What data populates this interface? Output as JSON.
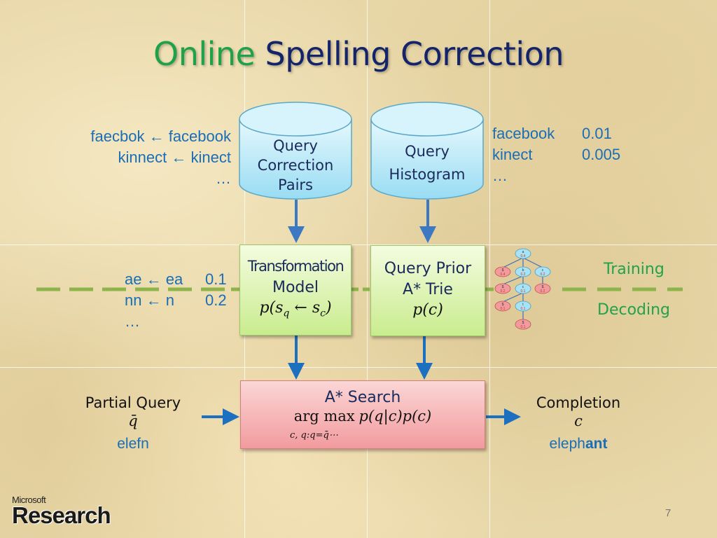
{
  "slide": {
    "title_highlight": "Online",
    "title_rest": "Spelling Correction",
    "page_number": "7",
    "logo": {
      "top": "Microsoft",
      "bottom": "Research"
    }
  },
  "colors": {
    "title_green": "#1fa14a",
    "title_navy": "#14246b",
    "example_blue": "#1a6eb5",
    "arrow_blue": "#2f76c0",
    "divider_green": "#8db34a",
    "cylinder_blue": "#a8e2f5",
    "model_green": "#c9ec8e",
    "search_red": "#f29b9e"
  },
  "correction_pairs_examples": {
    "rows": [
      {
        "query": "faecbok",
        "arrow": "←",
        "correction": "facebook"
      },
      {
        "query": "kinnect",
        "arrow": "←",
        "correction": "kinect"
      }
    ],
    "ellipsis": "…"
  },
  "histogram_examples": {
    "rows": [
      {
        "query": "facebook",
        "value": "0.01"
      },
      {
        "query": "kinect",
        "value": "0.005"
      }
    ],
    "ellipsis": "…"
  },
  "transformation_examples": {
    "rows": [
      {
        "from": "ae",
        "arrow": "←",
        "to": "ea",
        "value": "0.1"
      },
      {
        "from": "nn",
        "arrow": "←",
        "to": "n",
        "value": "0.2"
      }
    ],
    "ellipsis": "…"
  },
  "cylinders": {
    "correction_pairs": {
      "lines": [
        "Query",
        "Correction",
        "Pairs"
      ]
    },
    "histogram": {
      "lines": [
        "Query",
        "Histogram"
      ]
    }
  },
  "transformation_model": {
    "line1": "Transformation",
    "line2": "Model",
    "formula": "p(sⁱ ← sᶜ)",
    "formula_p": "p(",
    "formula_sq": "s",
    "formula_q_sub": "q",
    "formula_arrow": " ← ",
    "formula_sc": "s",
    "formula_c_sub": "c",
    "formula_close": ")"
  },
  "query_prior": {
    "line1": "Query Prior",
    "line2": "A* Trie",
    "formula": "p(c)"
  },
  "trie": {
    "nodes": [
      {
        "id": "root",
        "char": "a",
        "prob": "0.4",
        "kind": "inner"
      },
      {
        "id": "n1",
        "char": "$",
        "prob": "0.4",
        "kind": "end"
      },
      {
        "id": "n2",
        "char": "b",
        "prob": "0.2",
        "kind": "inner"
      },
      {
        "id": "n3",
        "char": "c",
        "prob": "0.2",
        "kind": "inner"
      },
      {
        "id": "n4",
        "char": "$",
        "prob": "0.2",
        "kind": "end"
      },
      {
        "id": "n5",
        "char": "c",
        "prob": "0.1",
        "kind": "inner"
      },
      {
        "id": "n6",
        "char": "$",
        "prob": "0.2",
        "kind": "end"
      },
      {
        "id": "n7",
        "char": "$",
        "prob": "0.1",
        "kind": "end"
      },
      {
        "id": "n8",
        "char": "t",
        "prob": "0.1",
        "kind": "inner"
      },
      {
        "id": "n9",
        "char": "$",
        "prob": "0.1",
        "kind": "end"
      }
    ]
  },
  "phases": {
    "training": "Training",
    "decoding": "Decoding"
  },
  "search": {
    "title": "A* Search",
    "argmax": "arg max",
    "objective": "p(q|c)p(c)",
    "subscript": "c, q:q=q̄⋯"
  },
  "input": {
    "label": "Partial Query",
    "symbol": "q̄",
    "example": "elefn"
  },
  "output": {
    "label": "Completion",
    "symbol": "c",
    "example_prefix": "eleph",
    "example_suffix": "ant"
  }
}
